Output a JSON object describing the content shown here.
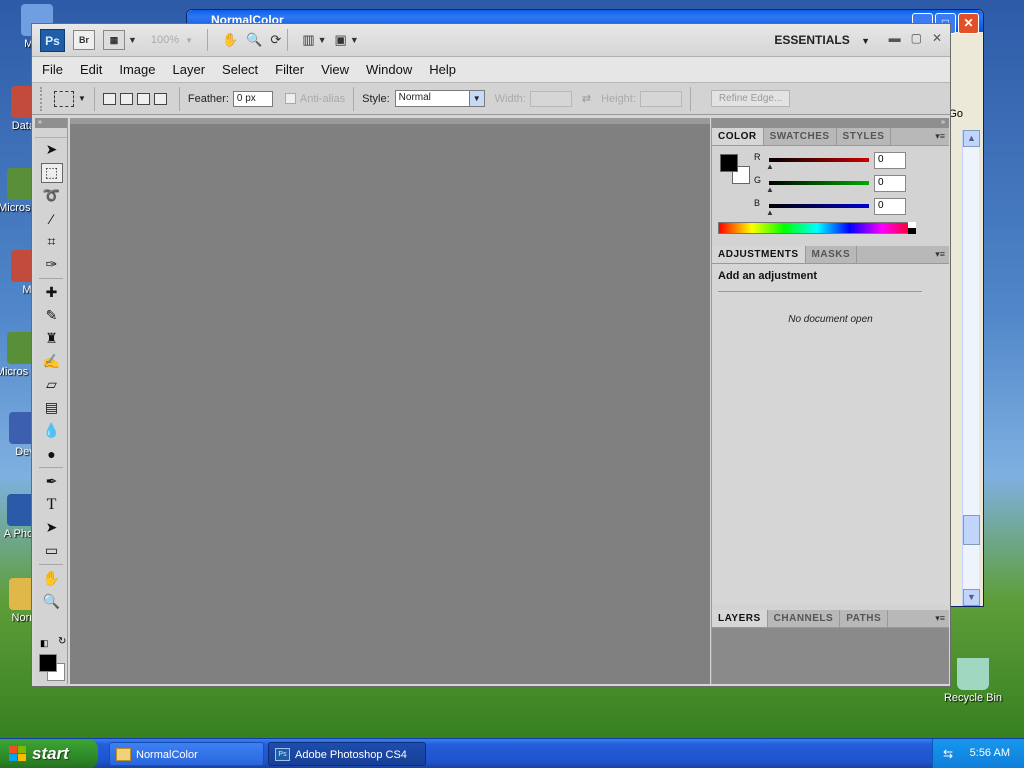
{
  "desktop": {
    "icons": [
      {
        "label": "My C",
        "color": "#6f9fe0"
      },
      {
        "label": "DataV",
        "color": "#c34b3b"
      },
      {
        "label": "Micros C+",
        "color": "#5a8f39"
      },
      {
        "label": "M",
        "color": "#c34b3b"
      },
      {
        "label": "Micros Bas",
        "color": "#5a8f39"
      },
      {
        "label": "Dev",
        "color": "#3c5fb0"
      },
      {
        "label": "A Photo",
        "color": "#2a5aa8"
      },
      {
        "label": "Norm",
        "color": "#e0b84a"
      }
    ],
    "recycle_bin": "Recycle Bin",
    "explorer_window": {
      "title": "NormalColor",
      "go_label": "Go"
    }
  },
  "photoshop": {
    "logo": "Ps",
    "bridge": "Br",
    "zoom": "100%",
    "workspace": "ESSENTIALS",
    "menu": [
      "File",
      "Edit",
      "Image",
      "Layer",
      "Select",
      "Filter",
      "View",
      "Window",
      "Help"
    ],
    "options": {
      "feather_label": "Feather:",
      "feather_value": "0 px",
      "antialias_label": "Anti-alias",
      "style_label": "Style:",
      "style_value": "Normal",
      "width_label": "Width:",
      "height_label": "Height:",
      "refine_edge": "Refine Edge..."
    },
    "panels": {
      "color_tabs": [
        "COLOR",
        "SWATCHES",
        "STYLES"
      ],
      "color_sliders": [
        {
          "label": "R",
          "value": "0",
          "color": "#cc0000"
        },
        {
          "label": "G",
          "value": "0",
          "color": "#00aa00"
        },
        {
          "label": "B",
          "value": "0",
          "color": "#0000cc"
        }
      ],
      "adjust_tabs": [
        "ADJUSTMENTS",
        "MASKS"
      ],
      "adjust_title": "Add an adjustment",
      "adjust_empty": "No document open",
      "layers_tabs": [
        "LAYERS",
        "CHANNELS",
        "PATHS"
      ]
    }
  },
  "taskbar": {
    "start": "start",
    "items": [
      {
        "label": "NormalColor",
        "active": false
      },
      {
        "label": "Adobe Photoshop CS4",
        "active": true
      }
    ],
    "clock": "5:56 AM"
  }
}
